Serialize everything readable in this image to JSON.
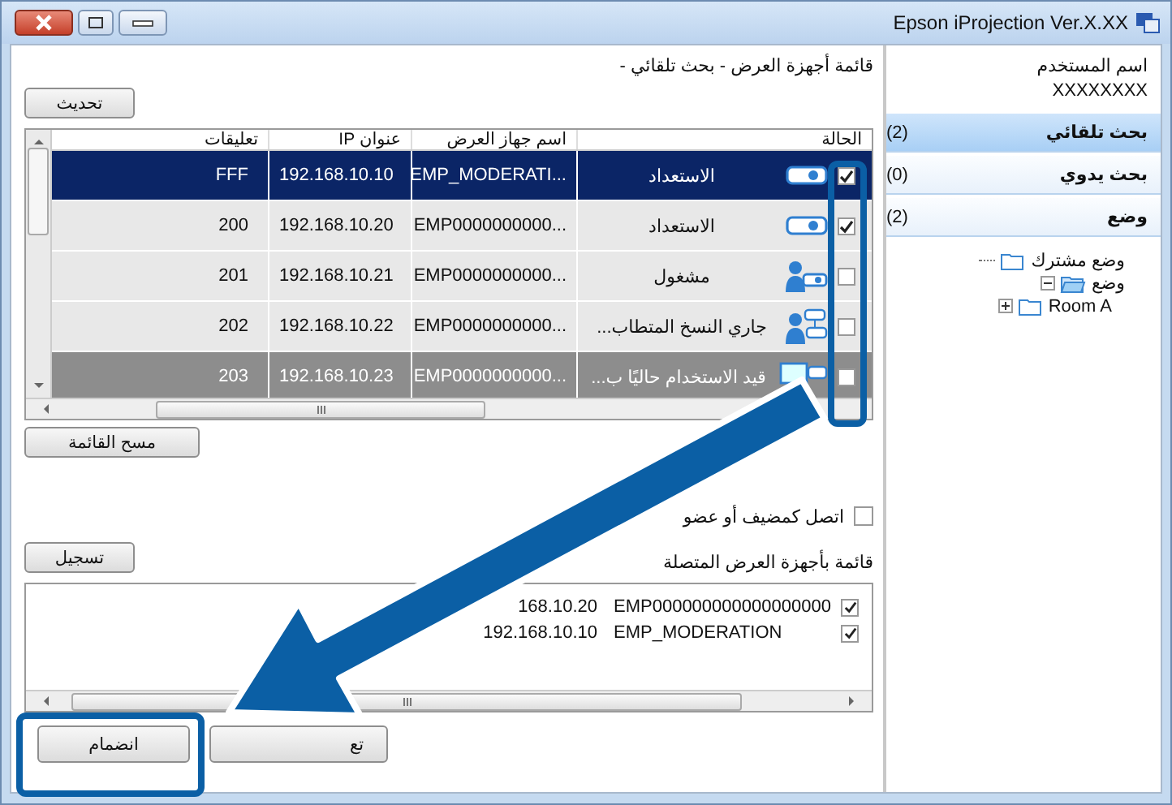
{
  "window": {
    "title": "Epson iProjection Ver.X.XX"
  },
  "main": {
    "header": "قائمة أجهزة العرض - بحث تلقائي -",
    "refresh_button": "تحديث",
    "table": {
      "columns": [
        "الحالة",
        "اسم جهاز العرض",
        "عنوان IP",
        "تعليقات"
      ],
      "rows": [
        {
          "checked": true,
          "selected": true,
          "disabled": false,
          "kind": "ready",
          "status": "الاستعداد",
          "name": "EMP_MODERATI...",
          "ip": "192.168.10.10",
          "comment": "FFF"
        },
        {
          "checked": true,
          "selected": false,
          "disabled": false,
          "kind": "ready",
          "status": "الاستعداد",
          "name": "EMP0000000000...",
          "ip": "192.168.10.20",
          "comment": "200"
        },
        {
          "checked": false,
          "selected": false,
          "disabled": false,
          "kind": "busy",
          "status": "مشغول",
          "name": "EMP0000000000...",
          "ip": "192.168.10.21",
          "comment": "201"
        },
        {
          "checked": false,
          "selected": false,
          "disabled": false,
          "kind": "copying",
          "status": "جاري النسخ المتطاب...",
          "name": "EMP0000000000...",
          "ip": "192.168.10.22",
          "comment": "202"
        },
        {
          "checked": false,
          "selected": false,
          "disabled": true,
          "kind": "in-use",
          "status": "قيد الاستخدام حاليًا ب...",
          "name": "EMP0000000000...",
          "ip": "192.168.10.23",
          "comment": "203"
        }
      ]
    },
    "clear_button": "مسح القائمة",
    "host_option": {
      "label": "اتصل كمضيف أو عضو",
      "checked": false
    },
    "register_button": "تسجيل",
    "connected_label": "قائمة بأجهزة العرض المتصلة",
    "connected": [
      {
        "name": "EMP000000000000000000",
        "ip": "168.10.20",
        "checked": true
      },
      {
        "name": "EMP_MODERATION",
        "ip": "192.168.10.10",
        "checked": true
      }
    ],
    "join_button": "انضمام",
    "second_button": "تع"
  },
  "sidebar": {
    "user_label": "اسم المستخدم",
    "user_name": "XXXXXXXX",
    "tabs": [
      {
        "label": "بحث تلقائي",
        "count": "(2)",
        "selected": true
      },
      {
        "label": "بحث يدوي",
        "count": "(0)",
        "selected": false
      },
      {
        "label": "وضع",
        "count": "(2)",
        "selected": false
      }
    ],
    "tree": [
      {
        "label": "وضع مشترك",
        "expanded": false
      },
      {
        "label": "وضع",
        "expanded": true,
        "children": [
          {
            "label": "Room A",
            "expanded": false,
            "has_children": true
          }
        ]
      }
    ]
  }
}
